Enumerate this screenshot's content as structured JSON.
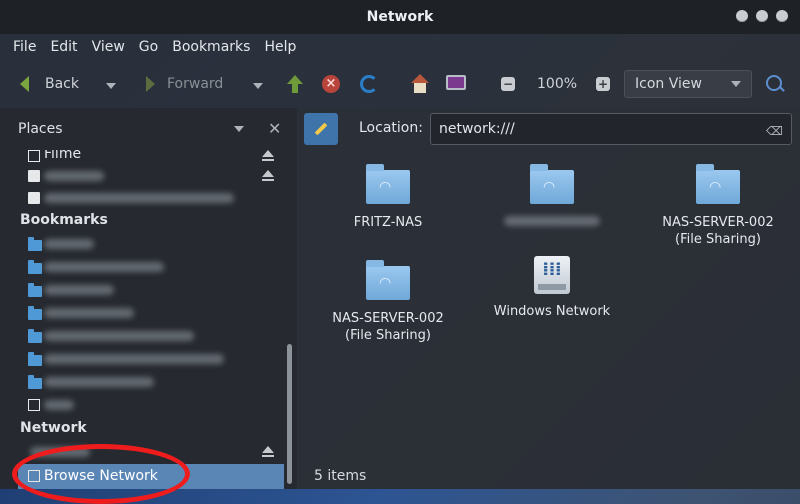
{
  "window": {
    "title": "Network"
  },
  "menubar": {
    "items": [
      "File",
      "Edit",
      "View",
      "Go",
      "Bookmarks",
      "Help"
    ]
  },
  "toolbar": {
    "back_label": "Back",
    "forward_label": "Forward",
    "zoom_level": "100%",
    "view_mode": "Icon View"
  },
  "sidebar": {
    "panel_title": "Places",
    "top_items": [
      {
        "label": "Filme"
      }
    ],
    "sections": {
      "bookmarks": "Bookmarks",
      "network": "Network"
    },
    "network_items": [
      {
        "label": "Browse Network",
        "selected": true
      }
    ]
  },
  "location": {
    "label": "Location:",
    "value": "network:///"
  },
  "items": [
    {
      "name": "FRITZ-NAS",
      "icon": "network-folder-icon"
    },
    {
      "name": "",
      "icon": "network-folder-icon"
    },
    {
      "name": "NAS-SERVER-002\n(File Sharing)",
      "icon": "network-folder-icon"
    },
    {
      "name": "NAS-SERVER-002\n(File Sharing)",
      "icon": "network-folder-icon"
    },
    {
      "name": "Windows Network",
      "icon": "windows-network-icon"
    }
  ],
  "status": {
    "text": "5 items"
  },
  "colors": {
    "selection": "#5a86b6",
    "annotation": "#ee1c1c",
    "folder": "#7fb4e2"
  }
}
